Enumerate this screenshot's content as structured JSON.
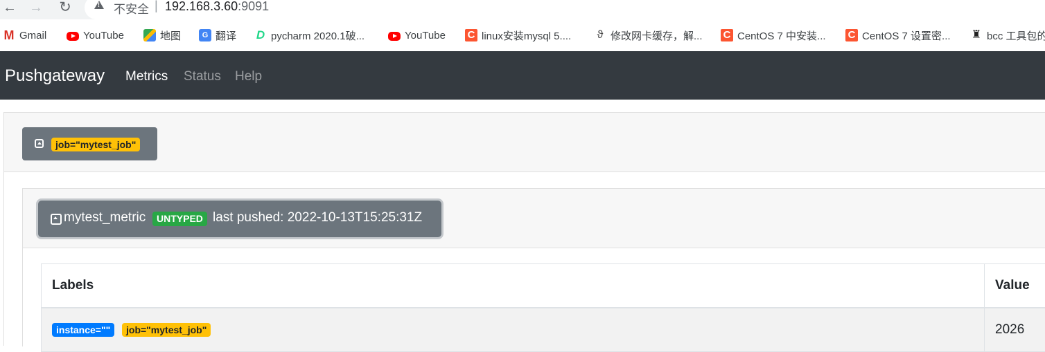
{
  "browser": {
    "security_label": "不安全",
    "url_host": "192.168.3.60",
    "url_port": ":9091",
    "bookmarks": [
      {
        "icon": "gmail-icon",
        "label": "Gmail"
      },
      {
        "icon": "youtube-icon",
        "label": "YouTube"
      },
      {
        "icon": "maps-icon",
        "label": "地图"
      },
      {
        "icon": "translate-icon",
        "label": "翻译"
      },
      {
        "icon": "pycharm-icon",
        "label": "pycharm 2020.1破..."
      },
      {
        "icon": "youtube-icon",
        "label": "YouTube"
      },
      {
        "icon": "csdn-icon",
        "label": "linux安装mysql 5...."
      },
      {
        "icon": "network-icon",
        "label": "修改网卡缓存，解..."
      },
      {
        "icon": "csdn-icon",
        "label": "CentOS 7 中安装..."
      },
      {
        "icon": "csdn-icon",
        "label": "CentOS 7 设置密..."
      },
      {
        "icon": "bcc-icon",
        "label": "bcc 工具包的"
      }
    ]
  },
  "navbar": {
    "brand": "Pushgateway",
    "links": [
      {
        "label": "Metrics",
        "active": true
      },
      {
        "label": "Status",
        "active": false
      },
      {
        "label": "Help",
        "active": false
      }
    ]
  },
  "job": {
    "label_badge": "job=\"mytest_job\""
  },
  "metric": {
    "name": "mytest_metric",
    "type_badge": "UNTYPED",
    "last_pushed": "last pushed: 2022-10-13T15:25:31Z",
    "table": {
      "headers": [
        "Labels",
        "Value"
      ],
      "rows": [
        {
          "labels": [
            "instance=\"\"",
            "job=\"mytest_job\""
          ],
          "value": "2026"
        }
      ]
    }
  },
  "colors": {
    "navbar_bg": "#343a40",
    "button_secondary": "#6c757d",
    "badge_warning": "#ffc107",
    "badge_success": "#28a745",
    "badge_primary": "#007bff"
  }
}
